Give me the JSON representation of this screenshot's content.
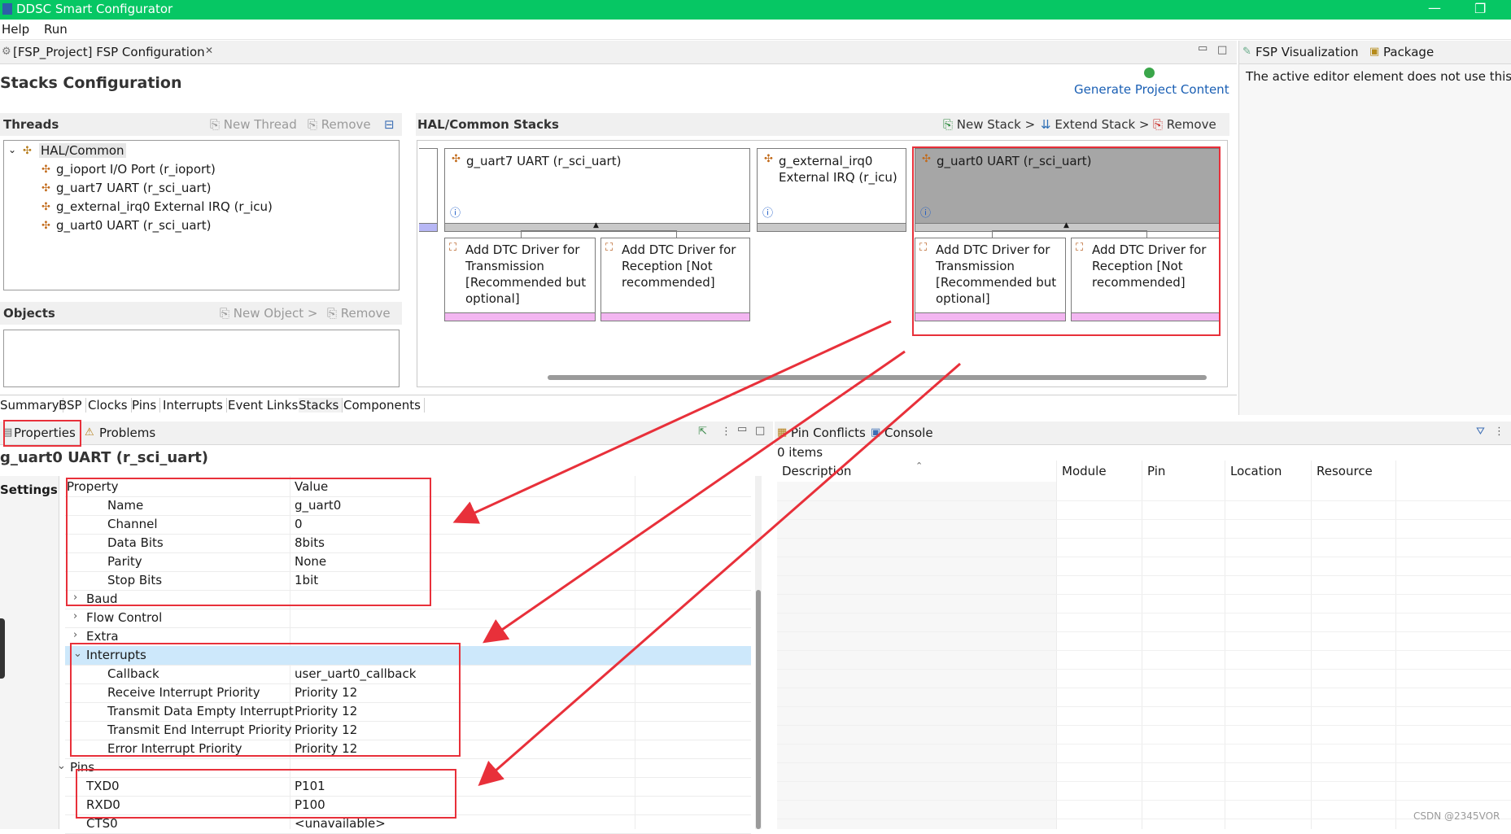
{
  "window": {
    "title": "DDSC Smart Configurator"
  },
  "menu": {
    "items": [
      "Help",
      "Run"
    ]
  },
  "editor": {
    "tab_label": "[FSP_Project] FSP Configuration",
    "heading": "Stacks Configuration",
    "generate_label": "Generate Project Content"
  },
  "right_panel": {
    "tab1": "FSP Visualization",
    "tab2": "Package",
    "message": "The active editor element does not use this vi"
  },
  "threads": {
    "title": "Threads",
    "new_thread": "New Thread",
    "remove": "Remove",
    "root": "HAL/Common",
    "items": [
      "g_ioport I/O Port (r_ioport)",
      "g_uart7 UART (r_sci_uart)",
      "g_external_irq0 External IRQ (r_icu)",
      "g_uart0 UART (r_sci_uart)"
    ]
  },
  "objects": {
    "title": "Objects",
    "new_object": "New Object >",
    "remove": "Remove"
  },
  "stacks": {
    "title": "HAL/Common Stacks",
    "new_stack": "New Stack >",
    "extend_stack": "Extend Stack >",
    "remove": "Remove",
    "mod_uart7": "g_uart7 UART (r_sci_uart)",
    "mod_irq_line1": "g_external_irq0",
    "mod_irq_line2": "External IRQ (r_icu)",
    "mod_uart0": "g_uart0 UART (r_sci_uart)",
    "dtc_tx": [
      "Add DTC Driver for",
      "Transmission",
      "[Recommended but",
      "optional]"
    ],
    "dtc_rx": [
      "Add DTC Driver for",
      "Reception [Not",
      "recommended]"
    ]
  },
  "config_tabs": [
    "Summary",
    "BSP",
    "Clocks",
    "Pins",
    "Interrupts",
    "Event Links",
    "Stacks",
    "Components"
  ],
  "props": {
    "tab_properties": "Properties",
    "tab_problems": "Problems",
    "heading": "g_uart0 UART (r_sci_uart)",
    "settings": "Settings",
    "col_property": "Property",
    "col_value": "Value",
    "rows": [
      {
        "p": "Name",
        "v": "g_uart0"
      },
      {
        "p": "Channel",
        "v": "0"
      },
      {
        "p": "Data Bits",
        "v": "8bits"
      },
      {
        "p": "Parity",
        "v": "None"
      },
      {
        "p": "Stop Bits",
        "v": "1bit"
      },
      {
        "p": "Baud",
        "v": ""
      },
      {
        "p": "Flow Control",
        "v": ""
      },
      {
        "p": "Extra",
        "v": ""
      },
      {
        "p": "Interrupts",
        "v": ""
      },
      {
        "p": "Callback",
        "v": "user_uart0_callback"
      },
      {
        "p": "Receive Interrupt Priority",
        "v": "Priority 12"
      },
      {
        "p": "Transmit Data Empty Interrupt Priority",
        "v": "Priority 12"
      },
      {
        "p": "Transmit End Interrupt Priority",
        "v": "Priority 12"
      },
      {
        "p": "Error Interrupt Priority",
        "v": "Priority 12"
      },
      {
        "p": "Pins",
        "v": ""
      },
      {
        "p": "TXD0",
        "v": "P101"
      },
      {
        "p": "RXD0",
        "v": "P100"
      },
      {
        "p": "CTS0",
        "v": "<unavailable>"
      }
    ]
  },
  "conflicts": {
    "tab_pin_conflicts": "Pin Conflicts",
    "tab_console": "Console",
    "count": "0 items",
    "columns": [
      "Description",
      "Module",
      "Pin",
      "Location",
      "Resource"
    ]
  },
  "watermark": "CSDN @2345VOR",
  "colors": {
    "title_green": "#06c764",
    "annotation_red": "#e8303a",
    "selected_module": "#a6a6a6",
    "selection_row": "#cde8fb"
  }
}
